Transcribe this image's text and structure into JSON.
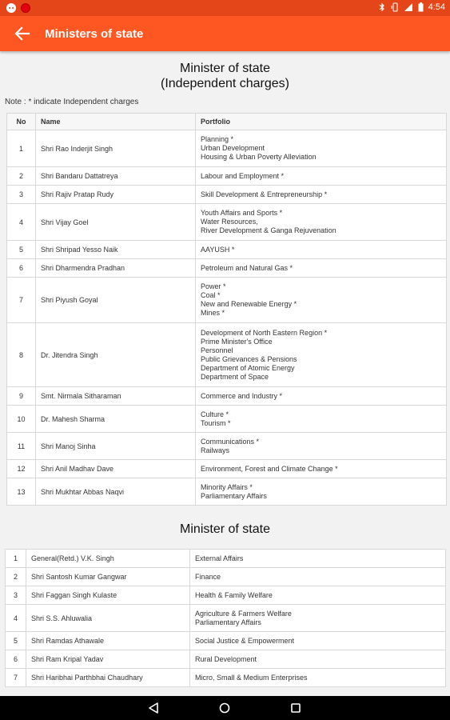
{
  "status_bar": {
    "time": "4:54"
  },
  "app_bar": {
    "title": "Ministers of state"
  },
  "section1": {
    "title_line1": "Minister of state",
    "title_line2": "(Independent charges)",
    "note": "Note : * indicate Independent charges",
    "headers": {
      "no": "No",
      "name": "Name",
      "portfolio": "Portfolio"
    },
    "rows": [
      {
        "no": "1",
        "name": "Shri Rao Inderjit Singh",
        "portfolio": [
          "Planning *",
          "Urban Development",
          "Housing & Urban Poverty Alleviation"
        ]
      },
      {
        "no": "2",
        "name": "Shri Bandaru Dattatreya",
        "portfolio": [
          "Labour and Employment *"
        ]
      },
      {
        "no": "3",
        "name": "Shri Rajiv Pratap Rudy",
        "portfolio": [
          "Skill Development & Entrepreneurship *"
        ]
      },
      {
        "no": "4",
        "name": "Shri Vijay Goel",
        "portfolio": [
          "Youth Affairs and Sports *",
          "Water Resources,",
          "River Development & Ganga Rejuvenation"
        ]
      },
      {
        "no": "5",
        "name": "Shri Shripad Yesso Naik",
        "portfolio": [
          "AAYUSH *"
        ]
      },
      {
        "no": "6",
        "name": "Shri Dharmendra Pradhan",
        "portfolio": [
          "Petroleum and Natural Gas *"
        ]
      },
      {
        "no": "7",
        "name": "Shri Piyush Goyal",
        "portfolio": [
          "Power *",
          "Coal *",
          "New and Renewable Energy *",
          "Mines *"
        ]
      },
      {
        "no": "8",
        "name": "Dr. Jitendra Singh",
        "portfolio": [
          "Development of North Eastern Region *",
          "Prime Minister's Office",
          "Personnel",
          "Public Grievances & Pensions",
          "Department of Atomic Energy",
          "Department of Space"
        ]
      },
      {
        "no": "9",
        "name": "Smt. Nirmala Sitharaman",
        "portfolio": [
          "Commerce and Industry *"
        ]
      },
      {
        "no": "10",
        "name": "Dr. Mahesh Sharma",
        "portfolio": [
          "Culture *",
          "Tourism *"
        ]
      },
      {
        "no": "11",
        "name": "Shri Manoj Sinha",
        "portfolio": [
          "Communications *",
          "Railways"
        ]
      },
      {
        "no": "12",
        "name": "Shri Anil Madhav Dave",
        "portfolio": [
          "Environment, Forest and Climate Change *"
        ]
      },
      {
        "no": "13",
        "name": "Shri Mukhtar Abbas Naqvi",
        "portfolio": [
          "Minority Affairs *",
          "Parliamentary Affairs"
        ]
      }
    ]
  },
  "section2": {
    "title": "Minister of state",
    "rows": [
      {
        "no": "1",
        "name": "General(Retd.) V.K. Singh",
        "portfolio": [
          "External Affairs"
        ]
      },
      {
        "no": "2",
        "name": "Shri Santosh Kumar Gangwar",
        "portfolio": [
          "Finance"
        ]
      },
      {
        "no": "3",
        "name": "Shri Faggan Singh Kulaste",
        "portfolio": [
          "Health & Family Welfare"
        ]
      },
      {
        "no": "4",
        "name": "Shri S.S. Ahluwalia",
        "portfolio": [
          "Agriculture & Farmers Welfare",
          "Parliamentary Affairs"
        ]
      },
      {
        "no": "5",
        "name": "Shri Ramdas Athawale",
        "portfolio": [
          "Social Justice & Empowerment"
        ]
      },
      {
        "no": "6",
        "name": "Shri Ram Kripal Yadav",
        "portfolio": [
          "Rural Development"
        ]
      },
      {
        "no": "7",
        "name": "Shri Haribhai Parthbhai Chaudhary",
        "portfolio": [
          "Micro, Small & Medium Enterprises"
        ]
      }
    ]
  },
  "icons": {
    "status_left": [
      "notification-icon",
      "record-icon"
    ],
    "status_right": [
      "bluetooth-icon",
      "vibrate-icon",
      "wifi-icon",
      "battery-icon"
    ],
    "app_bar": "back-arrow-icon",
    "nav": [
      "nav-back-icon",
      "nav-home-icon",
      "nav-recents-icon"
    ]
  },
  "colors": {
    "status_bar": "#e4461a",
    "app_bar": "#fe5722",
    "nav_bar": "#000000"
  }
}
